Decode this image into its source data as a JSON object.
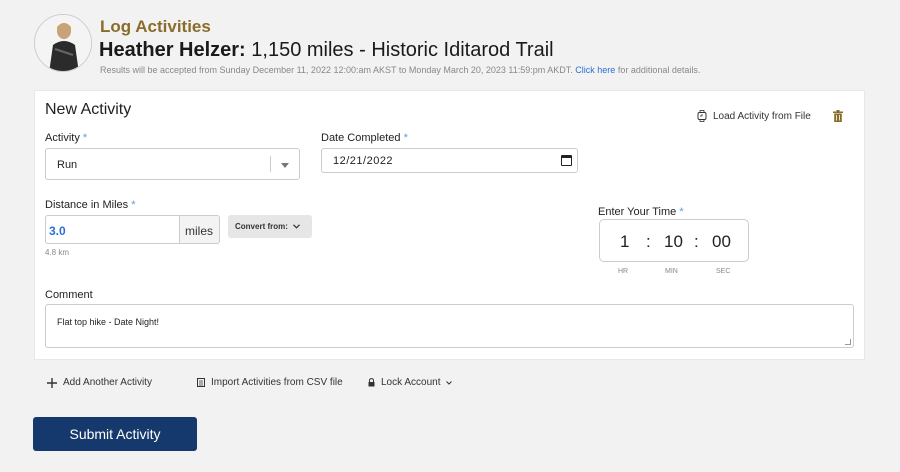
{
  "header": {
    "section_title": "Log Activities",
    "participant_name": "Heather Helzer:",
    "challenge": "1,150 miles - Historic Iditarod Trail",
    "note_text": "Results will be accepted from Sunday December 11, 2022 12:00:am AKST to Monday March 20, 2023 11:59:pm AKDT.",
    "note_link": "Click here",
    "note_suffix": "for additional details."
  },
  "form": {
    "title": "New Activity",
    "load_file_label": "Load Activity from File",
    "activity_label": "Activity",
    "activity_value": "Run",
    "date_label": "Date Completed",
    "date_value": "12/21/2022",
    "distance_label": "Distance in Miles",
    "distance_value": "3.0",
    "distance_unit": "miles",
    "convert_label": "Convert from:",
    "distance_km": "4.8 km",
    "time_label": "Enter Your Time",
    "time": {
      "hr": "1",
      "min": "10",
      "sec": "00",
      "hr_label": "HR",
      "min_label": "MIN",
      "sec_label": "SEC"
    },
    "comment_label": "Comment",
    "comment_value": "Flat top hike - Date Night!",
    "required_mark": "*"
  },
  "actions": {
    "add_another": "Add Another Activity",
    "import_csv": "Import Activities from CSV file",
    "lock_account": "Lock Account"
  },
  "submit_label": "Submit Activity",
  "colors": {
    "brand_gold": "#8a6d2a",
    "submit_bg": "#16396d",
    "link": "#2a6fd6"
  }
}
